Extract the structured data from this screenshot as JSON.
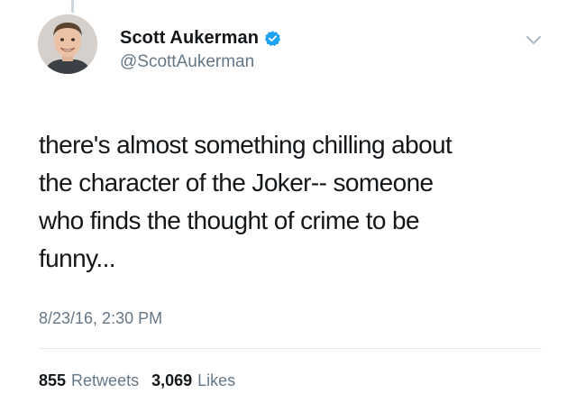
{
  "author": {
    "display_name": "Scott Aukerman",
    "handle": "@ScottAukerman",
    "verified": true,
    "avatar_icon": "user-avatar"
  },
  "menu_icon": "chevron-down-icon",
  "tweet": {
    "text": "there's almost something chilling about\nthe character of the Joker-- someone\nwho finds the thought of crime to be\nfunny...",
    "timestamp": "8/23/16, 2:30 PM"
  },
  "stats": {
    "retweets_count": "855",
    "retweets_label": "Retweets",
    "likes_count": "3,069",
    "likes_label": "Likes"
  },
  "colors": {
    "verified": "#1da1f2",
    "secondary_text": "#657786",
    "primary_text": "#14171a",
    "divider": "#e1e8ed"
  }
}
